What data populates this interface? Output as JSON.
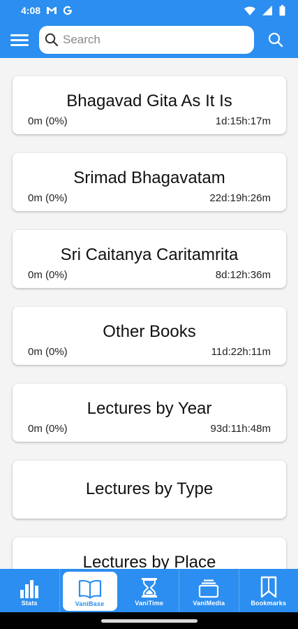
{
  "status": {
    "time": "4:08"
  },
  "search": {
    "placeholder": "Search",
    "value": ""
  },
  "cards": [
    {
      "title": "Bhagavad Gita As It Is",
      "progress": "0m (0%)",
      "duration": "1d:15h:17m"
    },
    {
      "title": "Srimad Bhagavatam",
      "progress": "0m (0%)",
      "duration": "22d:19h:26m"
    },
    {
      "title": "Sri Caitanya Caritamrita",
      "progress": "0m (0%)",
      "duration": "8d:12h:36m"
    },
    {
      "title": "Other Books",
      "progress": "0m (0%)",
      "duration": "11d:22h:11m"
    },
    {
      "title": "Lectures by Year",
      "progress": "0m (0%)",
      "duration": "93d:11h:48m"
    },
    {
      "title": "Lectures by Type"
    },
    {
      "title": "Lectures by Place"
    }
  ],
  "nav": {
    "stats": "Stats",
    "vanibase": "VaniBase",
    "vanitime": "VaniTime",
    "vanimedia": "VaniMedia",
    "bookmarks": "Bookmarks",
    "active": "VaniBase"
  },
  "colors": {
    "primary": "#2b8ef0",
    "background": "#f4f4f4",
    "card": "#ffffff"
  }
}
